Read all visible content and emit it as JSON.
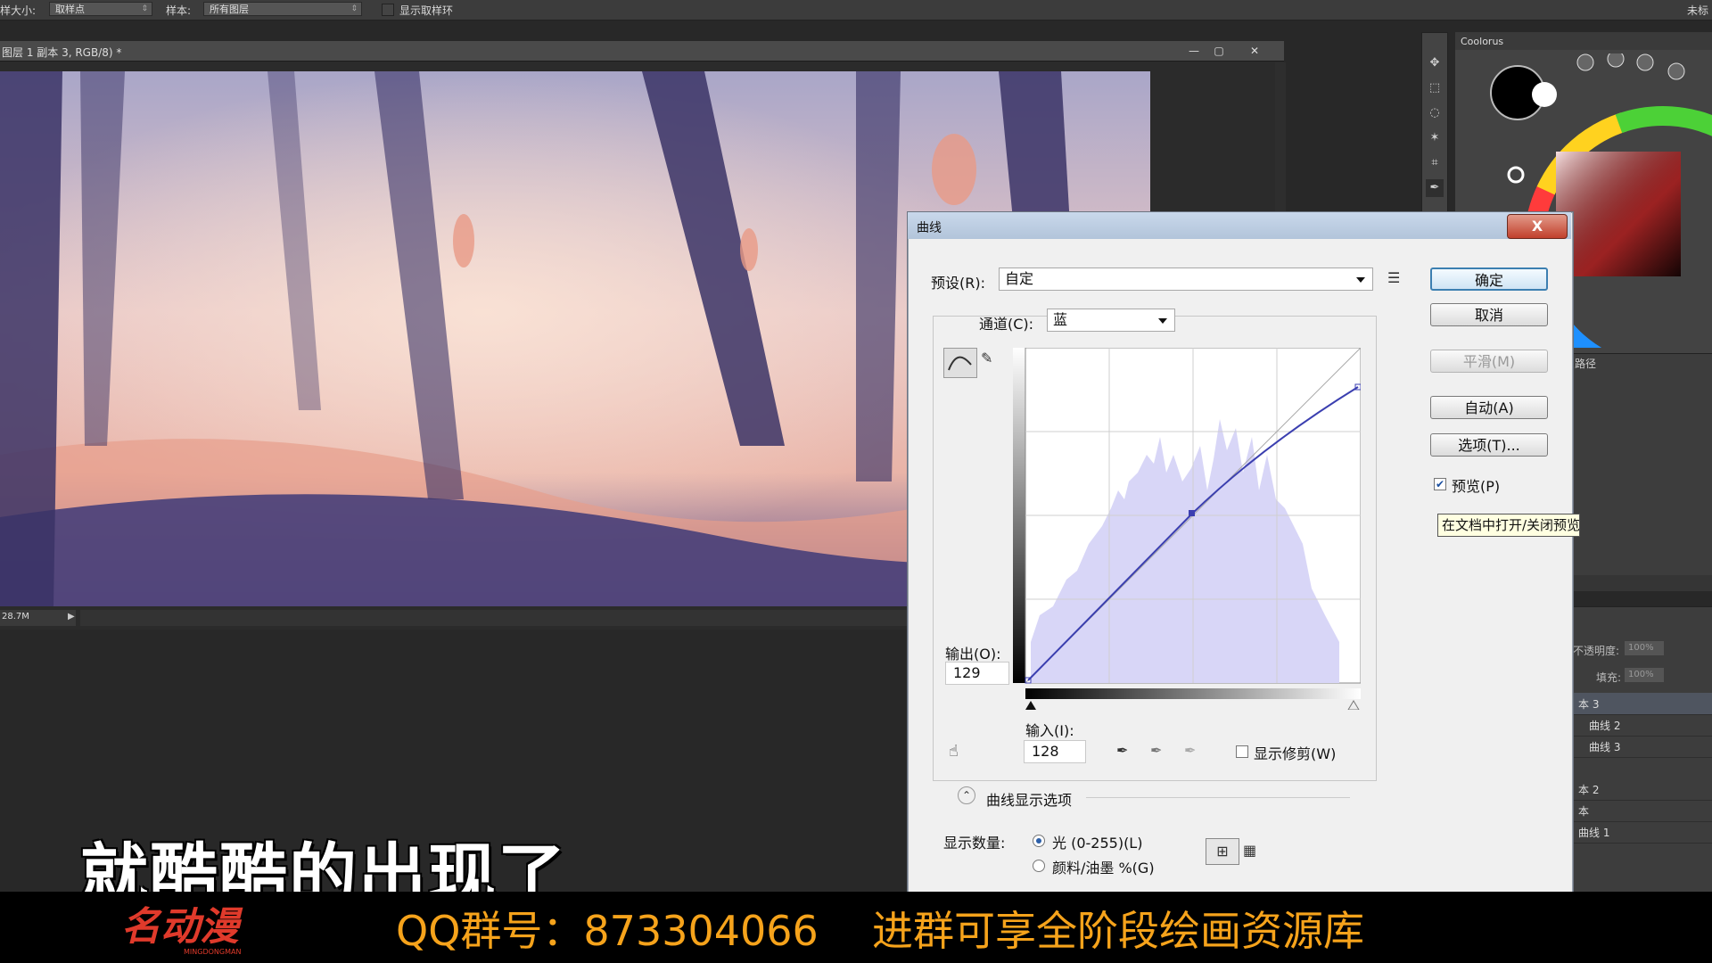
{
  "options_bar": {
    "sample_size_label": "样大小:",
    "sample_size_value": "取样点",
    "sample_label": "样本:",
    "sample_value": "所有图层",
    "show_ring_label": "显示取样环",
    "right_label": "未标"
  },
  "document": {
    "title": "图层 1 副本 3, RGB/8) *",
    "status": "28.7M"
  },
  "coolorus": {
    "tab": "Coolorus"
  },
  "panel2": {
    "partial_label": "路径"
  },
  "layers": {
    "opacity_label": "不透明度:",
    "opacity_value": "100%",
    "fill_label": "填充:",
    "fill_value": "100%",
    "rows": [
      {
        "label": "本 3"
      },
      {
        "label": "曲线 2"
      },
      {
        "label": "曲线 3"
      },
      {
        "label": "本 2"
      },
      {
        "label": "本"
      },
      {
        "label": "曲线 1"
      }
    ]
  },
  "curves_dialog": {
    "title": "曲线",
    "close": "X",
    "preset_label": "预设(R):",
    "preset_value": "自定",
    "channel_label": "通道(C):",
    "channel_value": "蓝",
    "output_label": "输出(O):",
    "output_value": "129",
    "input_label": "输入(I):",
    "input_value": "128",
    "show_clipping": "显示修剪(W)",
    "display_options": "曲线显示选项",
    "show_amount_label": "显示数量:",
    "light_option": "光 (0-255)(L)",
    "pigment_option": "颜料/油墨 %(G)",
    "buttons": {
      "ok": "确定",
      "cancel": "取消",
      "smooth": "平滑(M)",
      "auto": "自动(A)",
      "options": "选项(T)..."
    },
    "preview_label": "预览(P)",
    "preview_checked": true,
    "tooltip": "在文档中打开/关闭预览"
  },
  "caption": "就酷酷的出现了",
  "banner": {
    "qq": "QQ群号：873304066",
    "promo": "进群可享全阶段绘画资源库",
    "logo_text": "名动漫",
    "logo_sub": "MINGDONGMAN"
  },
  "colors": {
    "accent_orange": "#f6a31b",
    "curve_line": "#3b3fb0",
    "histogram": "#d8d6f7"
  }
}
